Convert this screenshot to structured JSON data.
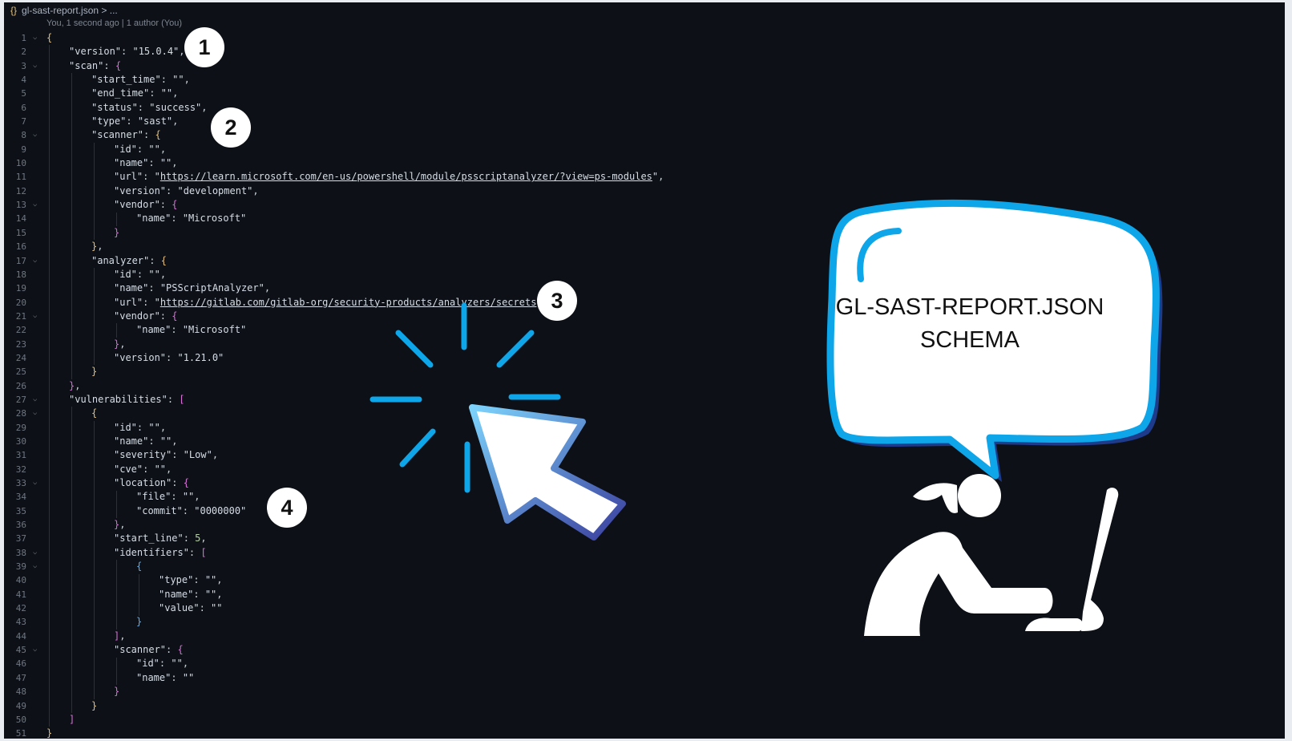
{
  "editor": {
    "breadcrumb": {
      "icon": "{}",
      "filename": "gl-sast-report.json",
      "trail": " > ..."
    },
    "blame": "You, 1 second ago | 1 author (You)"
  },
  "code_lines": [
    {
      "n": "1",
      "fold": true,
      "i": 0,
      "t": [
        [
          "b1",
          "{"
        ]
      ]
    },
    {
      "n": "2",
      "i": 1,
      "t": [
        [
          "k",
          "\"version\""
        ],
        [
          "p",
          ": "
        ],
        [
          "s",
          "\"15.0.4\""
        ],
        [
          "p",
          ","
        ]
      ]
    },
    {
      "n": "3",
      "fold": true,
      "i": 1,
      "t": [
        [
          "k",
          "\"scan\""
        ],
        [
          "p",
          ": "
        ],
        [
          "b2",
          "{"
        ]
      ]
    },
    {
      "n": "4",
      "i": 2,
      "t": [
        [
          "k",
          "\"start_time\""
        ],
        [
          "p",
          ": "
        ],
        [
          "s",
          "\"\""
        ],
        [
          "p",
          ","
        ]
      ]
    },
    {
      "n": "5",
      "i": 2,
      "t": [
        [
          "k",
          "\"end_time\""
        ],
        [
          "p",
          ": "
        ],
        [
          "s",
          "\"\""
        ],
        [
          "p",
          ","
        ]
      ]
    },
    {
      "n": "6",
      "i": 2,
      "t": [
        [
          "k",
          "\"status\""
        ],
        [
          "p",
          ": "
        ],
        [
          "s",
          "\"success\""
        ],
        [
          "p",
          ","
        ]
      ]
    },
    {
      "n": "7",
      "i": 2,
      "t": [
        [
          "k",
          "\"type\""
        ],
        [
          "p",
          ": "
        ],
        [
          "s",
          "\"sast\""
        ],
        [
          "p",
          ","
        ]
      ]
    },
    {
      "n": "8",
      "fold": true,
      "i": 2,
      "t": [
        [
          "k",
          "\"scanner\""
        ],
        [
          "p",
          ": "
        ],
        [
          "b1",
          "{"
        ]
      ]
    },
    {
      "n": "9",
      "i": 3,
      "t": [
        [
          "k",
          "\"id\""
        ],
        [
          "p",
          ": "
        ],
        [
          "s",
          "\"\""
        ],
        [
          "p",
          ","
        ]
      ]
    },
    {
      "n": "10",
      "i": 3,
      "t": [
        [
          "k",
          "\"name\""
        ],
        [
          "p",
          ": "
        ],
        [
          "s",
          "\"\""
        ],
        [
          "p",
          ","
        ]
      ]
    },
    {
      "n": "11",
      "i": 3,
      "t": [
        [
          "k",
          "\"url\""
        ],
        [
          "p",
          ": "
        ],
        [
          "s",
          "\""
        ],
        [
          "u",
          "https://learn.microsoft.com/en-us/powershell/module/psscriptanalyzer/?view=ps-modules"
        ],
        [
          "s",
          "\""
        ],
        [
          "p",
          ","
        ]
      ]
    },
    {
      "n": "12",
      "i": 3,
      "t": [
        [
          "k",
          "\"version\""
        ],
        [
          "p",
          ": "
        ],
        [
          "s",
          "\"development\""
        ],
        [
          "p",
          ","
        ]
      ]
    },
    {
      "n": "13",
      "fold": true,
      "i": 3,
      "t": [
        [
          "k",
          "\"vendor\""
        ],
        [
          "p",
          ": "
        ],
        [
          "b2",
          "{"
        ]
      ]
    },
    {
      "n": "14",
      "i": 4,
      "t": [
        [
          "k",
          "\"name\""
        ],
        [
          "p",
          ": "
        ],
        [
          "s",
          "\"Microsoft\""
        ]
      ]
    },
    {
      "n": "15",
      "i": 3,
      "t": [
        [
          "b2",
          "}"
        ]
      ]
    },
    {
      "n": "16",
      "i": 2,
      "t": [
        [
          "b1",
          "}"
        ],
        [
          "p",
          ","
        ]
      ]
    },
    {
      "n": "17",
      "fold": true,
      "i": 2,
      "t": [
        [
          "k",
          "\"analyzer\""
        ],
        [
          "p",
          ": "
        ],
        [
          "b1",
          "{"
        ]
      ]
    },
    {
      "n": "18",
      "i": 3,
      "t": [
        [
          "k",
          "\"id\""
        ],
        [
          "p",
          ": "
        ],
        [
          "s",
          "\"\""
        ],
        [
          "p",
          ","
        ]
      ]
    },
    {
      "n": "19",
      "i": 3,
      "t": [
        [
          "k",
          "\"name\""
        ],
        [
          "p",
          ": "
        ],
        [
          "s",
          "\"PSScriptAnalyzer\""
        ],
        [
          "p",
          ","
        ]
      ]
    },
    {
      "n": "20",
      "i": 3,
      "t": [
        [
          "k",
          "\"url\""
        ],
        [
          "p",
          ": "
        ],
        [
          "s",
          "\""
        ],
        [
          "u",
          "https://gitlab.com/gitlab-org/security-products/analyzers/secrets"
        ],
        [
          "s",
          "\""
        ],
        [
          "p",
          ","
        ]
      ]
    },
    {
      "n": "21",
      "fold": true,
      "i": 3,
      "t": [
        [
          "k",
          "\"vendor\""
        ],
        [
          "p",
          ": "
        ],
        [
          "b2",
          "{"
        ]
      ]
    },
    {
      "n": "22",
      "i": 4,
      "t": [
        [
          "k",
          "\"name\""
        ],
        [
          "p",
          ": "
        ],
        [
          "s",
          "\"Microsoft\""
        ]
      ]
    },
    {
      "n": "23",
      "i": 3,
      "t": [
        [
          "b2",
          "}"
        ],
        [
          "p",
          ","
        ]
      ]
    },
    {
      "n": "24",
      "i": 3,
      "t": [
        [
          "k",
          "\"version\""
        ],
        [
          "p",
          ": "
        ],
        [
          "s",
          "\"1.21.0\""
        ]
      ]
    },
    {
      "n": "25",
      "i": 2,
      "t": [
        [
          "b1",
          "}"
        ]
      ]
    },
    {
      "n": "26",
      "i": 1,
      "t": [
        [
          "b2",
          "}"
        ],
        [
          "p",
          ","
        ]
      ]
    },
    {
      "n": "27",
      "fold": true,
      "i": 1,
      "t": [
        [
          "k",
          "\"vulnerabilities\""
        ],
        [
          "p",
          ": "
        ],
        [
          "b2",
          "["
        ]
      ]
    },
    {
      "n": "28",
      "fold": true,
      "i": 2,
      "t": [
        [
          "b1",
          "{"
        ]
      ]
    },
    {
      "n": "29",
      "i": 3,
      "t": [
        [
          "k",
          "\"id\""
        ],
        [
          "p",
          ": "
        ],
        [
          "s",
          "\"\""
        ],
        [
          "p",
          ","
        ]
      ]
    },
    {
      "n": "30",
      "i": 3,
      "t": [
        [
          "k",
          "\"name\""
        ],
        [
          "p",
          ": "
        ],
        [
          "s",
          "\"\""
        ],
        [
          "p",
          ","
        ]
      ]
    },
    {
      "n": "31",
      "i": 3,
      "t": [
        [
          "k",
          "\"severity\""
        ],
        [
          "p",
          ": "
        ],
        [
          "s",
          "\"Low\""
        ],
        [
          "p",
          ","
        ]
      ]
    },
    {
      "n": "32",
      "i": 3,
      "t": [
        [
          "k",
          "\"cve\""
        ],
        [
          "p",
          ": "
        ],
        [
          "s",
          "\"\""
        ],
        [
          "p",
          ","
        ]
      ]
    },
    {
      "n": "33",
      "fold": true,
      "i": 3,
      "t": [
        [
          "k",
          "\"location\""
        ],
        [
          "p",
          ": "
        ],
        [
          "b2",
          "{"
        ]
      ]
    },
    {
      "n": "34",
      "i": 4,
      "t": [
        [
          "k",
          "\"file\""
        ],
        [
          "p",
          ": "
        ],
        [
          "s",
          "\"\""
        ],
        [
          "p",
          ","
        ]
      ]
    },
    {
      "n": "35",
      "i": 4,
      "t": [
        [
          "k",
          "\"commit\""
        ],
        [
          "p",
          ": "
        ],
        [
          "s",
          "\"0000000\""
        ]
      ]
    },
    {
      "n": "36",
      "i": 3,
      "t": [
        [
          "b2",
          "}"
        ],
        [
          "p",
          ","
        ]
      ]
    },
    {
      "n": "37",
      "i": 3,
      "t": [
        [
          "k",
          "\"start_line\""
        ],
        [
          "p",
          ": "
        ],
        [
          "n",
          "5"
        ],
        [
          "p",
          ","
        ]
      ]
    },
    {
      "n": "38",
      "fold": true,
      "i": 3,
      "t": [
        [
          "k",
          "\"identifiers\""
        ],
        [
          "p",
          ": "
        ],
        [
          "b2",
          "["
        ]
      ]
    },
    {
      "n": "39",
      "fold": true,
      "i": 4,
      "t": [
        [
          "b3",
          "{"
        ]
      ]
    },
    {
      "n": "40",
      "i": 5,
      "t": [
        [
          "k",
          "\"type\""
        ],
        [
          "p",
          ": "
        ],
        [
          "s",
          "\"\""
        ],
        [
          "p",
          ","
        ]
      ]
    },
    {
      "n": "41",
      "i": 5,
      "t": [
        [
          "k",
          "\"name\""
        ],
        [
          "p",
          ": "
        ],
        [
          "s",
          "\"\""
        ],
        [
          "p",
          ","
        ]
      ]
    },
    {
      "n": "42",
      "i": 5,
      "t": [
        [
          "k",
          "\"value\""
        ],
        [
          "p",
          ": "
        ],
        [
          "s",
          "\"\""
        ]
      ]
    },
    {
      "n": "43",
      "i": 4,
      "t": [
        [
          "b3",
          "}"
        ]
      ]
    },
    {
      "n": "44",
      "i": 3,
      "t": [
        [
          "b2",
          "]"
        ],
        [
          "p",
          ","
        ]
      ]
    },
    {
      "n": "45",
      "fold": true,
      "i": 3,
      "t": [
        [
          "k",
          "\"scanner\""
        ],
        [
          "p",
          ": "
        ],
        [
          "b2",
          "{"
        ]
      ]
    },
    {
      "n": "46",
      "i": 4,
      "t": [
        [
          "k",
          "\"id\""
        ],
        [
          "p",
          ": "
        ],
        [
          "s",
          "\"\""
        ],
        [
          "p",
          ","
        ]
      ]
    },
    {
      "n": "47",
      "i": 4,
      "t": [
        [
          "k",
          "\"name\""
        ],
        [
          "p",
          ": "
        ],
        [
          "s",
          "\"\""
        ]
      ]
    },
    {
      "n": "48",
      "i": 3,
      "t": [
        [
          "b2",
          "}"
        ]
      ]
    },
    {
      "n": "49",
      "i": 2,
      "t": [
        [
          "b1",
          "}"
        ]
      ]
    },
    {
      "n": "50",
      "i": 1,
      "t": [
        [
          "b2",
          "]"
        ]
      ]
    },
    {
      "n": "51",
      "i": 0,
      "t": [
        [
          "b1",
          "}"
        ]
      ]
    }
  ],
  "badges": [
    "1",
    "2",
    "3",
    "4"
  ],
  "bubble": {
    "line1": "GL-SAST-REPORT.JSON",
    "line2": "SCHEMA"
  },
  "colors": {
    "accent_blue": "#0ea5e9",
    "background": "#0d1117",
    "cursor_gradient_start": "#7dd3fc",
    "cursor_gradient_end": "#3b3f9e"
  }
}
